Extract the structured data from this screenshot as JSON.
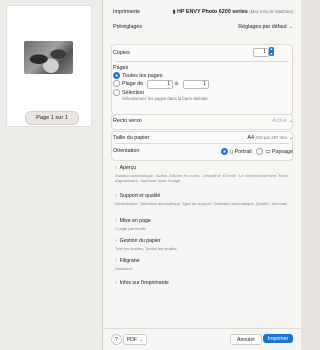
{
  "preview": {
    "page_indicator": "Page 1 sur 1"
  },
  "dialog": {
    "printer_label": "Imprimante",
    "printer_value": "HP ENVY Photo 6200 series",
    "printer_note": "(Mac mini de Matthieu)",
    "presets_label": "Préréglages",
    "presets_value": "Réglages par défaut",
    "copies_label": "Copies",
    "copies_value": "1",
    "pages_label": "Pages",
    "pages_all": "Toutes les pages",
    "pages_range": "Plage de",
    "range_from": "1",
    "range_to_label": "à",
    "range_to": "1",
    "pages_selection": "Sélection",
    "pages_selection_hint": "Sélectionnez les pages dans la barre latérale",
    "duplex_label": "Recto verso",
    "duplex_value": "Activé",
    "paper_label": "Taille du papier",
    "paper_value": "A4",
    "paper_dims": "210 par 297 mm",
    "orientation_label": "Orientation",
    "portrait": "Portrait",
    "landscape": "Paysage",
    "sections": [
      {
        "title": "Aperçu",
        "desc": "Rotation automatique : Activé, Afficher les notes : Désactivé, Échelle : Le dimensionnement, Mode d'ajustement : Imprimer toute l'image"
      },
      {
        "title": "Support et qualité",
        "desc": "Alimentation : Sélection automatique, Type de support : Sélection automatique, Qualité : Normale"
      },
      {
        "title": "Mise en page",
        "desc": "1 page par feuille"
      },
      {
        "title": "Gestion du papier",
        "desc": "Trier les feuilles, Toutes les feuilles"
      },
      {
        "title": "Filigrane",
        "desc": "Désactivé"
      },
      {
        "title": "Infos sur l'imprimante",
        "desc": ""
      }
    ],
    "help": "?",
    "pdf": "PDF",
    "cancel": "Annuler",
    "print": "Imprimer"
  }
}
